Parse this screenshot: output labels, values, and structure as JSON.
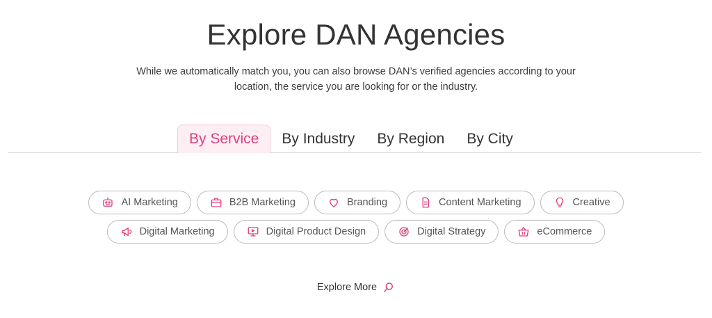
{
  "header": {
    "title": "Explore DAN Agencies",
    "subtitle": "While we automatically match you, you can also browse DAN’s verified agencies according to your location, the service you are looking for or the industry."
  },
  "tabs": [
    {
      "label": "By Service",
      "active": true
    },
    {
      "label": "By Industry",
      "active": false
    },
    {
      "label": "By Region",
      "active": false
    },
    {
      "label": "By City",
      "active": false
    }
  ],
  "services": {
    "row1": [
      {
        "label": "AI Marketing",
        "icon": "robot-icon"
      },
      {
        "label": "B2B Marketing",
        "icon": "briefcase-icon"
      },
      {
        "label": "Branding",
        "icon": "heart-icon"
      },
      {
        "label": "Content Marketing",
        "icon": "document-icon"
      },
      {
        "label": "Creative",
        "icon": "lightbulb-icon"
      }
    ],
    "row2": [
      {
        "label": "Digital Marketing",
        "icon": "megaphone-icon"
      },
      {
        "label": "Digital Product Design",
        "icon": "monitor-icon"
      },
      {
        "label": "Digital Strategy",
        "icon": "target-icon"
      },
      {
        "label": "eCommerce",
        "icon": "basket-icon"
      }
    ]
  },
  "footer": {
    "explore_label": "Explore More",
    "explore_icon": "search-icon"
  },
  "colors": {
    "accent": "#e03e7c",
    "accent_bg": "#fdeef4",
    "text": "#333333",
    "chip_border": "#b9b9b9"
  }
}
